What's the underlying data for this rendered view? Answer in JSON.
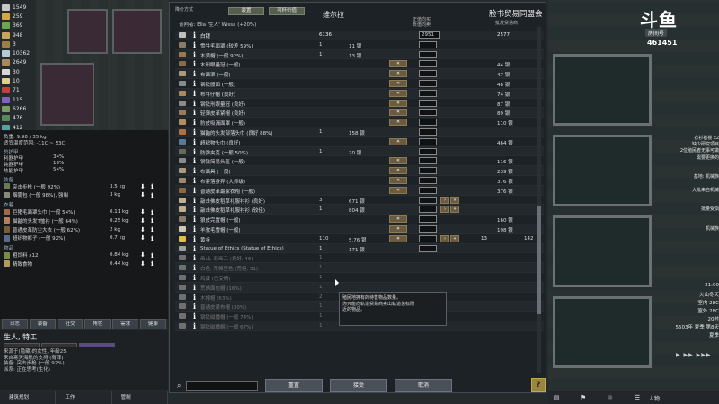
{
  "resources": [
    {
      "value": "1549",
      "color": "#c9c9c9"
    },
    {
      "value": "259",
      "color": "#d4a34a"
    },
    {
      "value": "369",
      "color": "#6aa84f"
    },
    {
      "value": "948",
      "color": "#c7a55a"
    },
    {
      "value": "3",
      "color": "#9b7e4a"
    },
    {
      "value": "10362",
      "color": "#b5c9d6"
    },
    {
      "value": "2649",
      "color": "#a88a5a"
    },
    {
      "value": "30",
      "color": "#d8d8d8"
    },
    {
      "value": "10",
      "color": "#e0d090"
    },
    {
      "value": "71",
      "color": "#c04040"
    },
    {
      "value": "115",
      "color": "#8060c0"
    },
    {
      "value": "6266",
      "color": "#7a9a6a"
    },
    {
      "value": "476",
      "color": "#5a8a5a"
    },
    {
      "value": "412",
      "color": "#5aa0a0"
    }
  ],
  "info": {
    "mass": "负重: 9.98 / 35 kg",
    "comfort": "适宜温度范围: -11C ~ 53C",
    "armor_head": "总护甲",
    "armor": [
      {
        "label": "利器护甲",
        "value": "34%"
      },
      {
        "label": "钝器护甲",
        "value": "10%"
      },
      {
        "label": "热能护甲",
        "value": "54%"
      }
    ],
    "equip_head": "装备",
    "equip": [
      {
        "name": "突击步枪 (一般 92%)",
        "weight": "3.5 kg",
        "color": "#6b7a58"
      },
      {
        "name": "烟雾包 (一般 98%), 强制",
        "weight": "3 kg",
        "color": "#8a8a7a"
      }
    ],
    "apparel_head": "衣着",
    "apparel": [
      {
        "name": "巨猪毛面罩头巾 (一般 54%)",
        "weight": "0.11 kg",
        "color": "#9a6a4a"
      },
      {
        "name": "猫鼬的头发T恤衫 (一般 64%)",
        "weight": "0.25 kg",
        "color": "#b08060"
      },
      {
        "name": "普通皮革防尘大衣 (一般 62%)",
        "weight": "2 kg",
        "color": "#7a5a3a"
      },
      {
        "name": "超织物裤子 (一般 92%)",
        "weight": "0.7 kg",
        "color": "#5a6a8a"
      }
    ],
    "inventory_head": "物品",
    "inventory": [
      {
        "name": "粗饲料 x12",
        "weight": "0.84 kg",
        "color": "#7a8a4a"
      },
      {
        "name": "精致食物",
        "weight": "0.44 kg",
        "color": "#b09a60"
      }
    ]
  },
  "tabs": [
    "日志",
    "装备",
    "社交",
    "角色",
    "需求",
    "健康"
  ],
  "pawn": {
    "name": "生人, 特工",
    "lines": [
      "来源于(隐藏)的女性, 年龄25",
      "来自寒天海航的支持 (有罪)",
      "装备: 突击步枪 (一般 92%)",
      "派系: 正在思考(生化)"
    ]
  },
  "bottom_left": [
    "建筑规划",
    "工作",
    "管制"
  ],
  "dialog": {
    "top_label": "降价方式",
    "tab1": "装置",
    "tab2": "可杯价值",
    "negotiator": "谈判者: Ella '生人' Wissa (+20%)",
    "colony_title": "维尔拉",
    "trader_title": "脸书贸易同盟会",
    "trader_sub": "批发贸易商",
    "mid_label1": "正值向买",
    "mid_label2": "负值向卖",
    "rows": [
      {
        "name": "白银",
        "colony": "6136",
        "price": "",
        "input": "2951",
        "trader": "2577",
        "extra": "",
        "icon": "#c0c0c0",
        "header": true
      },
      {
        "name": "雪牛毛面罩 (较差 59%)",
        "colony": "1",
        "price": "11 银",
        "trader": "",
        "extra": "",
        "icon": "#8a7a6a",
        "larrow": false,
        "rarrow": false
      },
      {
        "name": "木壳帽 (一般 92%)",
        "colony": "1",
        "price": "13 银",
        "trader": "",
        "extra": "",
        "icon": "#9a7a4a",
        "larrow": false,
        "rarrow": false
      },
      {
        "name": "木刑眼量冠 (一般)",
        "colony": "",
        "price": "",
        "trader": "44 银",
        "extra": "",
        "icon": "#8a6a4a",
        "larrow": true,
        "rarrow": false
      },
      {
        "name": "布面罩 (一般)",
        "colony": "",
        "price": "",
        "trader": "47 银",
        "extra": "",
        "icon": "#aa9a7a",
        "larrow": true,
        "rarrow": false
      },
      {
        "name": "钢铁骰面 (一般)",
        "colony": "",
        "price": "",
        "trader": "48 银",
        "extra": "",
        "icon": "#8a8a8a",
        "larrow": true,
        "rarrow": false
      },
      {
        "name": "布牛仔帽 (良好)",
        "colony": "",
        "price": "",
        "trader": "74 银",
        "extra": "",
        "icon": "#aa8a5a",
        "larrow": true,
        "rarrow": false
      },
      {
        "name": "钢铁刑眼量冠 (良好)",
        "colony": "",
        "price": "",
        "trader": "87 银",
        "extra": "",
        "icon": "#8a8a8a",
        "larrow": true,
        "rarrow": false
      },
      {
        "name": "轻薄皮革紧帽 (良好)",
        "colony": "",
        "price": "",
        "trader": "89 银",
        "extra": "",
        "icon": "#9a7a5a",
        "larrow": true,
        "rarrow": false
      },
      {
        "name": "豹皮吸漏面罩 (一般)",
        "colony": "",
        "price": "",
        "trader": "110 银",
        "extra": "",
        "icon": "#b09060",
        "larrow": true,
        "rarrow": false
      },
      {
        "name": "猫鼬的头发部落头巾 (良好 88%)",
        "colony": "1",
        "price": "158 银",
        "trader": "",
        "extra": "",
        "icon": "#b07040",
        "larrow": false,
        "rarrow": false
      },
      {
        "name": "超织物头巾 (良好)",
        "colony": "",
        "price": "",
        "trader": "464 银",
        "extra": "",
        "icon": "#5a7a9a",
        "larrow": true,
        "rarrow": false
      },
      {
        "name": "防弹夹克 (一般 50%)",
        "colony": "1",
        "price": "20 银",
        "trader": "",
        "extra": "",
        "icon": "#6a6a5a",
        "larrow": false,
        "rarrow": false
      },
      {
        "name": "钢铁简易头盔 (一般)",
        "colony": "",
        "price": "",
        "trader": "116 银",
        "extra": "",
        "icon": "#8a8a8a",
        "larrow": true,
        "rarrow": false
      },
      {
        "name": "布面具 (一般)",
        "colony": "",
        "price": "",
        "trader": "239 银",
        "extra": "",
        "icon": "#aa9a7a",
        "larrow": true,
        "rarrow": false
      },
      {
        "name": "布套落身弃 (大师级)",
        "colony": "",
        "price": "",
        "trader": "376 银",
        "extra": "",
        "icon": "#9a8a6a",
        "larrow": true,
        "rarrow": false
      },
      {
        "name": "普通皮革最家衣袍 (一般)",
        "colony": "",
        "price": "",
        "trader": "376 银",
        "extra": "",
        "icon": "#8a6a3a",
        "larrow": true,
        "rarrow": false
      },
      {
        "name": "敲击佛皮稻草礼服衬衫 (良好)",
        "colony": "3",
        "price": "671 银",
        "trader": "",
        "extra": "",
        "icon": "#c0b090",
        "larrow": false,
        "rarrow": true
      },
      {
        "name": "敲击佛皮稻草礼服衬衫 (较佳)",
        "colony": "1",
        "price": "804 银",
        "trader": "",
        "extra": "",
        "icon": "#c0b090",
        "larrow": false,
        "rarrow": true
      },
      {
        "name": "狼皮完置帽 (一般)",
        "colony": "",
        "price": "",
        "trader": "160 银",
        "extra": "",
        "icon": "#8a7a6a",
        "larrow": true,
        "rarrow": false
      },
      {
        "name": "羊驼毛雪帽 (一般)",
        "colony": "",
        "price": "",
        "trader": "198 银",
        "extra": "",
        "icon": "#d0c8b0",
        "larrow": true,
        "rarrow": false
      },
      {
        "name": "黄金",
        "colony": "110",
        "price": "5.76 银",
        "trader": "13",
        "extra": "142",
        "icon": "#e0c040",
        "larrow": true,
        "rarrow": true,
        "silver": true
      },
      {
        "name": "Statue of Ethics (Statue of Ethics)",
        "colony": "1",
        "price": "171 银",
        "trader": "",
        "extra": "",
        "icon": "#a0a0a0",
        "larrow": false,
        "rarrow": false
      },
      {
        "name": "画山, 彩画工 (良好, 46)",
        "colony": "1",
        "price": "",
        "trader": "",
        "extra": "",
        "icon": "#707070",
        "dim": true
      },
      {
        "name": "白色, 荒棉里色 (荒格, 31)",
        "colony": "1",
        "price": "",
        "trader": "",
        "extra": "",
        "icon": "#707070",
        "dim": true
      },
      {
        "name": "鸡蛋 (已受精)",
        "colony": "1",
        "price": "",
        "trader": "",
        "extra": "",
        "icon": "#707070",
        "dim": true
      },
      {
        "name": "荒肉面包帽 (16%)",
        "colony": "1",
        "price": "",
        "trader": "",
        "extra": "",
        "icon": "#707070",
        "dim": true
      },
      {
        "name": "木帽帽 (63%)",
        "colony": "2",
        "price": "",
        "trader": "",
        "extra": "",
        "icon": "#707070",
        "dim": true
      },
      {
        "name": "普通皮蓬布帽 (30%)",
        "colony": "1",
        "price": "",
        "trader": "",
        "extra": "",
        "icon": "#707070",
        "dim": true
      },
      {
        "name": "钢铁磁播帽 (一般 74%)",
        "colony": "1",
        "price": "",
        "trader": "",
        "extra": "",
        "icon": "#707070",
        "dim": true
      },
      {
        "name": "钢铁磁播帽 (一般 67%)",
        "colony": "1",
        "price": "",
        "trader": "",
        "extra": "",
        "icon": "#707070",
        "dim": true
      }
    ],
    "tooltip": [
      "殖民地拥有的待售物品数量。",
      "你只能向轨道贸易商卖出轨道信标附",
      "近的物品。"
    ],
    "btn_reset": "重置",
    "btn_accept": "接受",
    "btn_cancel": "取消",
    "help": "?"
  },
  "overlay": {
    "logo": "斗鱼",
    "logo_sub": "房间号",
    "room_id": "461451",
    "lines": [
      "衣衫褴褛 x2",
      "缺少研究项目",
      "2位殖民者无事可做",
      "需要更换的",
      "",
      "",
      "基地: 机械族",
      "",
      "大批来自机械",
      "",
      "",
      "批量受损",
      "",
      "",
      "机械族"
    ],
    "clock": [
      "21:00",
      "火山冬天",
      "室内 28C",
      "室外 28C",
      "20时",
      "5503年 夏季 第8天",
      "夏季"
    ],
    "speed": "▶ ▶▶ ▶▶▶",
    "bottom_right": "人物"
  }
}
